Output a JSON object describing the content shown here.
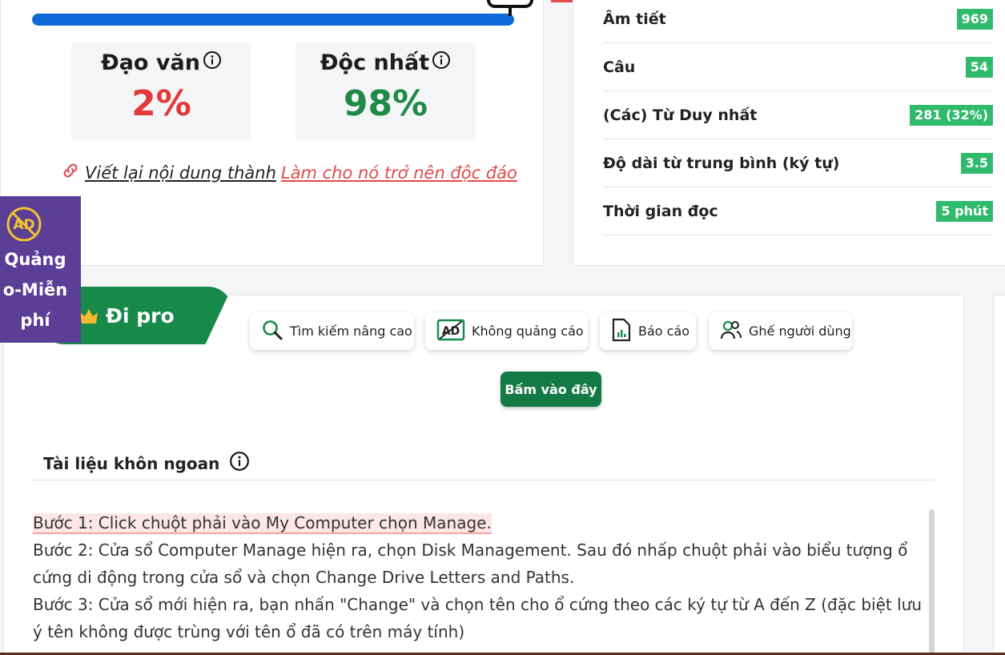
{
  "progress": {
    "plagiarism_fraction": 1.0
  },
  "scores": {
    "plagiarism_label": "Đạo văn",
    "plagiarism_value": "2%",
    "unique_label": "Độc nhất",
    "unique_value": "98%"
  },
  "rewrite": {
    "prefix": "Viết lại nội dung thành",
    "link": "Làm cho nó trở nên độc đáo"
  },
  "stats": [
    {
      "label": "Âm tiết",
      "value": "969"
    },
    {
      "label": "Câu",
      "value": "54"
    },
    {
      "label": "(Các) Từ Duy nhất",
      "value": "281 (32%)"
    },
    {
      "label": "Độ dài từ trung bình (ký tự)",
      "value": "3.5"
    },
    {
      "label": "Thời gian đọc",
      "value": "5 phút"
    }
  ],
  "ad_badge": {
    "text": "Quảng\no-Miễn\nphí"
  },
  "pro": {
    "ribbon_label": "Đi pro",
    "features": [
      {
        "label": "Tìm kiếm nâng cao",
        "icon": "search-icon"
      },
      {
        "label": "Không quảng cáo",
        "icon": "no-ads-icon"
      },
      {
        "label": "Báo cáo",
        "icon": "report-icon"
      },
      {
        "label": "Ghế người dùng",
        "icon": "users-icon"
      }
    ],
    "cta_label": "Bấm vào đây"
  },
  "document": {
    "title": "Tài liệu khôn ngoan",
    "lines": [
      "Bước 1: Click chuột phải vào My Computer chọn Manage.",
      "Bước 2: Cửa sổ Computer Manage hiện ra, chọn Disk Management. Sau đó nhấp chuột phải vào biểu tượng ổ cứng di động trong cửa sổ và chọn Change Drive Letters and Paths.",
      "Bước 3: Cửa sổ mới hiện ra, bạn nhấn \"Change\" và chọn tên cho ổ cứng theo các ký tự từ A đến Z (đặc biệt lưu ý tên không được trùng với tên ổ đã có trên máy tính)"
    ]
  },
  "colors": {
    "red": "#e03a3a",
    "green": "#1e8a45",
    "badge_green": "#2fba6c",
    "blue": "#0d6ad8",
    "purple": "#5b3e96",
    "dark_green": "#147a45"
  }
}
